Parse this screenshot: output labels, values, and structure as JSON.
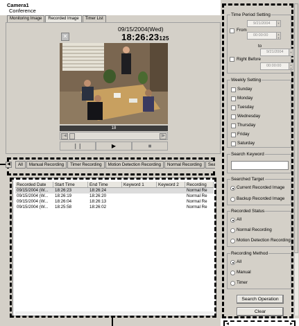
{
  "camera": {
    "title": "Camera1",
    "subtitle": "Conference"
  },
  "view_tabs": [
    "Monitoring Image",
    "Recorded Image",
    "Timer List"
  ],
  "viewer": {
    "date": "09/15/2004(Wed)",
    "time": "18:26:23",
    "time_fraction": "125",
    "frame_counter": "18",
    "seek_position": 0.0
  },
  "icons": {
    "zoom": "zoom-toggle-icon",
    "seek_prev": "arrow-left-icon",
    "seek_next": "arrow-right-icon",
    "pause": "pause-icon",
    "play": "play-icon",
    "stop": "stop-icon",
    "list_left": "arrow-left-icon"
  },
  "list_tabs": [
    "All",
    "Manual Recording",
    "Timer Recording",
    "Motion Detection Recording",
    "Normal Recording",
    "Search"
  ],
  "list": {
    "columns": [
      "Recorded Date",
      "Start Time",
      "End Time",
      "Keyword 1",
      "Keyword 2",
      "Recording"
    ],
    "rows": [
      [
        "09/15/2004 (W...",
        "18:26:23",
        "18:26:24",
        "",
        "",
        "Normal Re"
      ],
      [
        "09/15/2004 (W...",
        "18:26:19",
        "18:26:20",
        "",
        "",
        "Normal Re"
      ],
      [
        "09/15/2004 (W...",
        "18:26:04",
        "18:26:13",
        "",
        "",
        "Normal Re"
      ],
      [
        "09/15/2004 (W...",
        "18:25:58",
        "18:26:02",
        "",
        "",
        "Normal Re"
      ]
    ]
  },
  "search_panel": {
    "time_period": {
      "label": "Time Period Setting",
      "from_label": "From",
      "from_date": "9/21/2004",
      "from_time": "00:00:00",
      "to_label": "to",
      "to_date": "9/21/2004",
      "to_time": "00:00:00",
      "right_before_label": "Right Before"
    },
    "weekly": {
      "label": "Weekly Setting",
      "days": [
        "Sunday",
        "Monday",
        "Tuesday",
        "Wednesday",
        "Thursday",
        "Friday",
        "Saturday"
      ]
    },
    "keyword": {
      "label": "Search Keyword",
      "value": ""
    },
    "target": {
      "label": "Searched Target",
      "options": [
        "Current Recorded Image",
        "Backup Recorded Image"
      ],
      "selected": 0
    },
    "status": {
      "label": "Recorded Status",
      "options": [
        "All",
        "Normal Recording",
        "Motion Detection Recording"
      ],
      "selected": 0
    },
    "method": {
      "label": "Recording Method",
      "options": [
        "All",
        "Manual",
        "Timer"
      ],
      "selected": 0
    },
    "search_button": "Search Operation",
    "clear_button": "Clear"
  }
}
